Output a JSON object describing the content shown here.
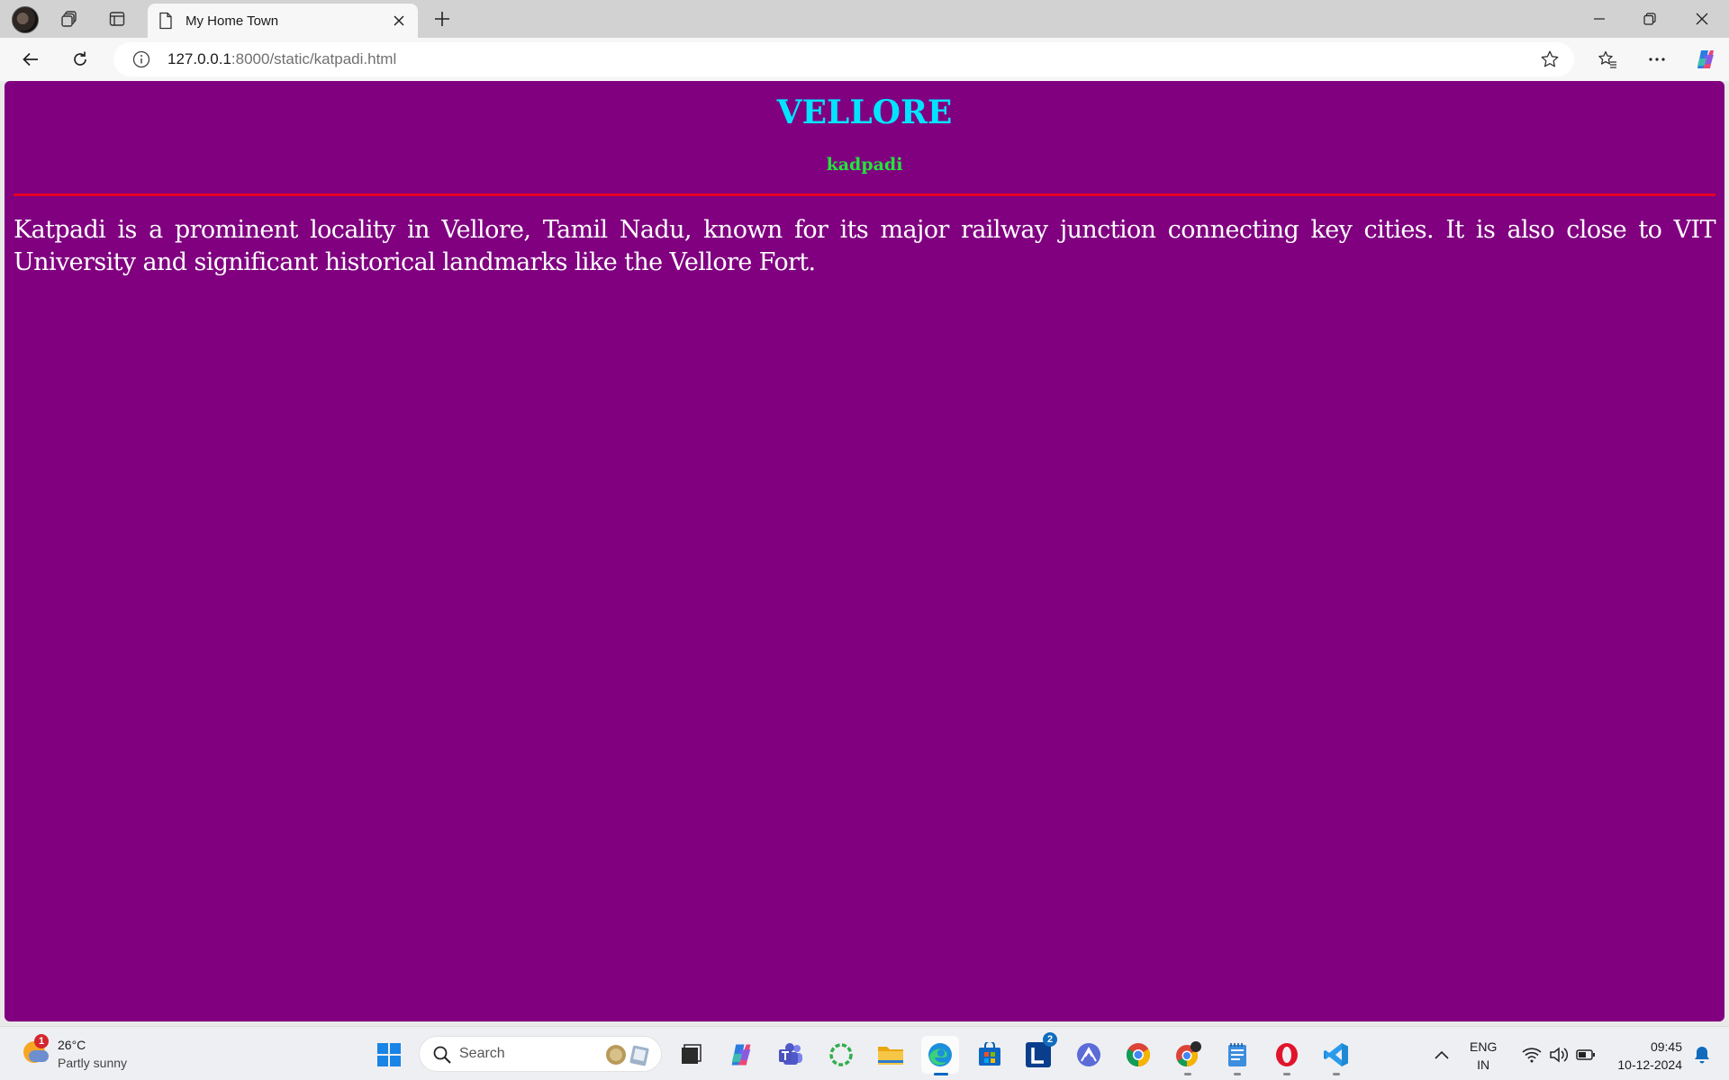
{
  "browser": {
    "tab": {
      "title": "My Home Town",
      "icon": "page-icon"
    },
    "address": {
      "host": "127.0.0.1",
      "rest": ":8000/static/katpadi.html"
    },
    "toolbar_icons": [
      "back-icon",
      "refresh-icon",
      "info-icon",
      "star-icon",
      "favorites-icon",
      "more-icon",
      "copilot-icon"
    ],
    "window_controls": [
      "minimize-icon",
      "restore-icon",
      "close-icon"
    ]
  },
  "page": {
    "background": "#800080",
    "heading": "VELLORE",
    "heading_color": "#00e5ff",
    "subheading": "kadpadi",
    "subheading_color": "#22e63a",
    "rule_color": "#e80022",
    "paragraph": "Katpadi is a prominent locality in Vellore, Tamil Nadu, known for its major railway junction connecting key cities. It is also close to VIT University and significant historical landmarks like the Vellore Fort."
  },
  "taskbar": {
    "weather": {
      "badge": "1",
      "temp": "26°C",
      "condition": "Partly sunny"
    },
    "search_placeholder": "Search",
    "apps": [
      "windows-start",
      "file-icon",
      "copilot",
      "teams",
      "green-ring-app",
      "file-explorer",
      "edge",
      "microsoft-store",
      "l-app",
      "a-app",
      "chrome",
      "chrome-profile",
      "notepad",
      "opera",
      "vscode"
    ],
    "l_app_badge": "2",
    "language": {
      "line1": "ENG",
      "line2": "IN"
    },
    "clock": {
      "time": "09:45",
      "date": "10-12-2024"
    }
  }
}
